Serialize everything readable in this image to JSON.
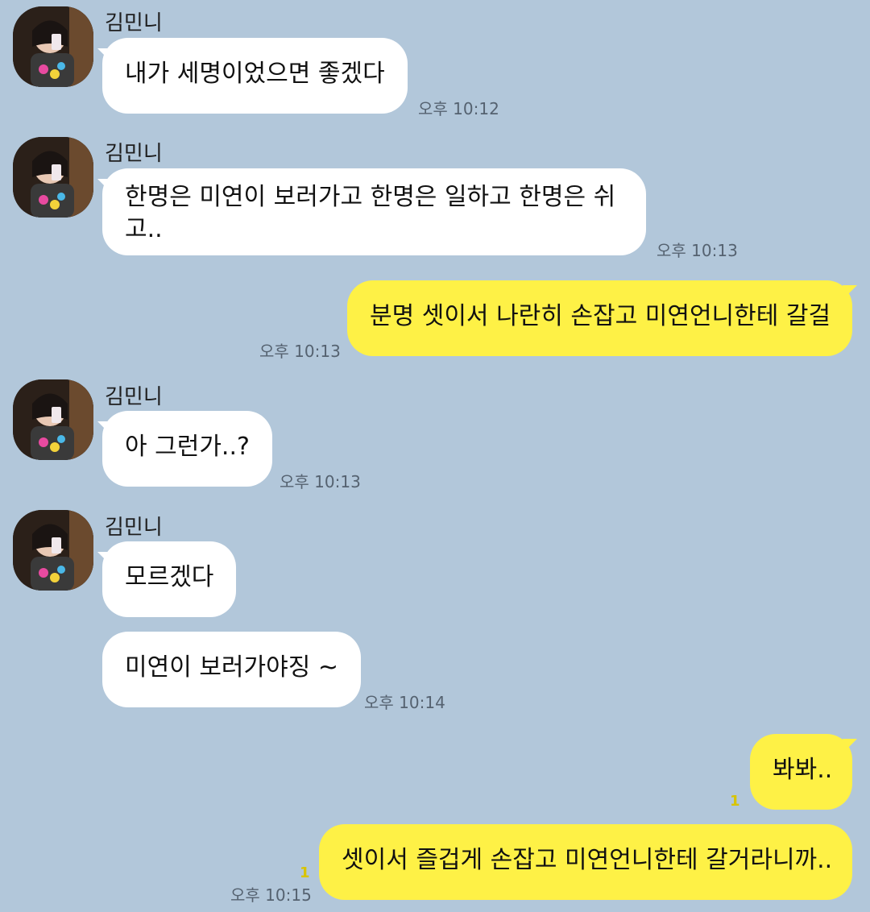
{
  "chat": {
    "messages": [
      {
        "sender": "김민니",
        "text": "내가 세명이었으면 좋겠다",
        "time": "오후 10:12"
      },
      {
        "sender": "김민니",
        "text": "한명은 미연이 보러가고 한명은 일하고 한명은 쉬고..",
        "time": "오후 10:13"
      },
      {
        "text": "분명 셋이서 나란히 손잡고 미연언니한테 갈걸",
        "time": "오후 10:13"
      },
      {
        "sender": "김민니",
        "text": "아 그런가..?",
        "time": "오후 10:13"
      },
      {
        "sender": "김민니",
        "text": "모르겠다"
      },
      {
        "text": "미연이 보러가야징 ~",
        "time": "오후 10:14"
      },
      {
        "text": "봐봐..",
        "unread": "1"
      },
      {
        "text": "셋이서 즐겁게 손잡고 미연언니한테 갈거라니까..",
        "unread": "1",
        "time": "오후 10:15"
      }
    ]
  },
  "colors": {
    "background": "#b2c7da",
    "incoming_bubble": "#ffffff",
    "outgoing_bubble": "#fef146",
    "unread": "#d8c400"
  }
}
